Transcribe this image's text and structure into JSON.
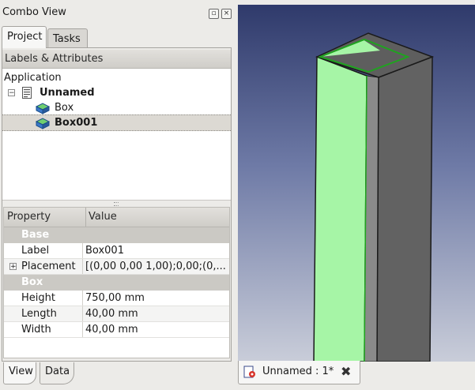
{
  "combo_view": {
    "title": "Combo View",
    "float_icon": "float-window-icon",
    "close_icon": "close-icon",
    "tabs": [
      {
        "label": "Project",
        "active": true
      },
      {
        "label": "Tasks",
        "active": false
      }
    ]
  },
  "tree": {
    "header": "Labels & Attributes",
    "root": "Application",
    "document": {
      "label": "Unnamed",
      "expander": "−",
      "icon": "document-icon"
    },
    "items": [
      {
        "label": "Box",
        "icon": "part-box-icon",
        "selected": false
      },
      {
        "label": "Box001",
        "icon": "part-box-icon",
        "selected": true
      }
    ]
  },
  "properties": {
    "columns": [
      "Property",
      "Value"
    ],
    "groups": [
      {
        "name": "Base",
        "rows": [
          {
            "name": "Label",
            "value": "Box001"
          },
          {
            "name": "Placement",
            "value": "[(0,00 0,00 1,00);0,00;(0,...",
            "expandable": true
          }
        ]
      },
      {
        "name": "Box",
        "rows": [
          {
            "name": "Height",
            "value": "750,00 mm"
          },
          {
            "name": "Length",
            "value": "40,00 mm"
          },
          {
            "name": "Width",
            "value": "40,00 mm"
          }
        ]
      }
    ],
    "plus_symbol": "+"
  },
  "bottom_tabs": [
    {
      "label": "View",
      "active": false
    },
    {
      "label": "Data",
      "active": true
    }
  ],
  "document_tab": {
    "label": "Unnamed : 1*",
    "icon": "freecad-document-icon",
    "close_symbol": "✖"
  },
  "colors": {
    "selection_green": "#a6f5a6",
    "box_face_dark": "#5f5f5f",
    "box_face_mid": "#8a8a8a",
    "edge_green": "#1fa31f"
  }
}
